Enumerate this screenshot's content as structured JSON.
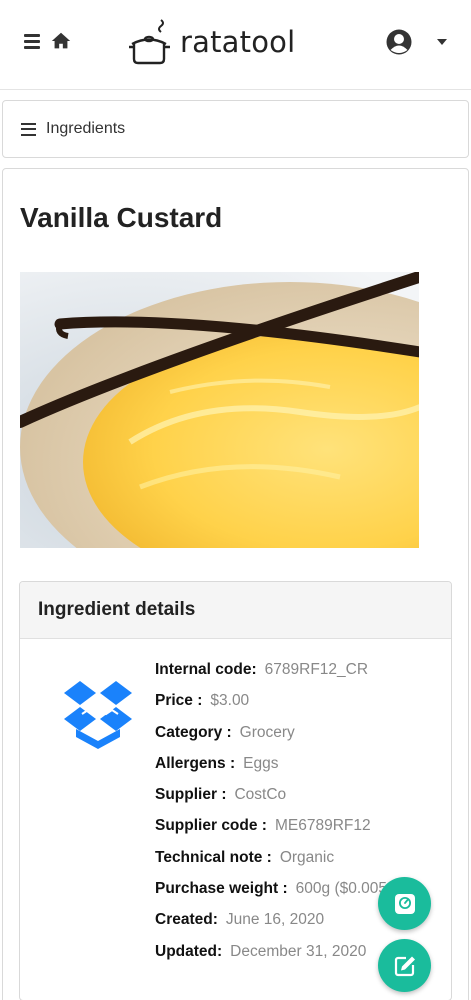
{
  "header": {
    "brand_name": "ratatool"
  },
  "breadcrumb": {
    "label": "Ingredients"
  },
  "ingredient": {
    "title": "Vanilla Custard"
  },
  "details": {
    "heading": "Ingredient details",
    "rows": [
      {
        "label": "Internal code:",
        "value": "6789RF12_CR"
      },
      {
        "label": "Price :",
        "value": "$3.00"
      },
      {
        "label": "Category :",
        "value": "Grocery"
      },
      {
        "label": "Allergens :",
        "value": "Eggs"
      },
      {
        "label": "Supplier :",
        "value": "CostCo"
      },
      {
        "label": "Supplier code :",
        "value": "ME6789RF12"
      },
      {
        "label": "Technical note :",
        "value": "Organic"
      },
      {
        "label": "Purchase weight :",
        "value": "600g ($0.005/g)"
      },
      {
        "label": "Created:",
        "value": "June 16, 2020"
      },
      {
        "label": "Updated:",
        "value": "December 31, 2020"
      }
    ]
  },
  "icons": {
    "menu": "bars-icon",
    "home": "home-icon",
    "logo": "cooking-pot-icon",
    "user": "user-circle-icon",
    "caret": "caret-down-icon",
    "ingredient": "dropbox-box-icon",
    "fab_top": "kitchen-scale-icon",
    "fab_bottom": "edit-icon"
  },
  "colors": {
    "accent": "#1abc9c",
    "box_blue": "#1a82fb",
    "muted_text": "#888888"
  }
}
